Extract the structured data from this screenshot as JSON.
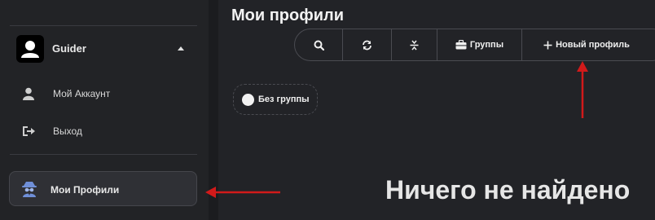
{
  "sidebar": {
    "account": {
      "name": "Guider"
    },
    "items": [
      {
        "label": "Мой Аккаунт",
        "icon": "user-icon"
      },
      {
        "label": "Выход",
        "icon": "logout-icon"
      }
    ],
    "profiles": {
      "label": "Мои Профили",
      "icon": "spy-agent-icon"
    }
  },
  "main": {
    "title": "Мои профили",
    "toolbar": {
      "search_icon": "search-icon",
      "refresh_icon": "refresh-icon",
      "collapse_icon": "collapse-vertical-icon",
      "groups_label": "Группы",
      "new_profile_label": "Новый профиль"
    },
    "group_chip": {
      "label": "Без группы"
    },
    "empty_state": "Ничего не найдено"
  },
  "annotations": {
    "arrow_color": "#d11a1a"
  }
}
